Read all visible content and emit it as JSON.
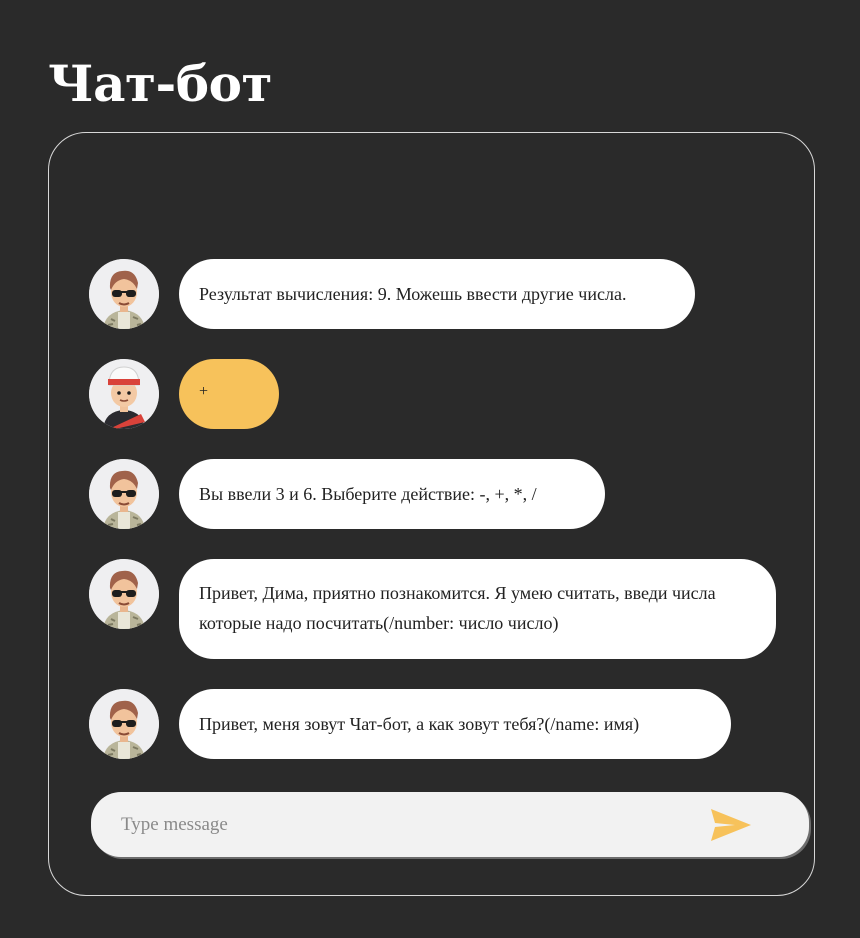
{
  "header": {
    "title": "Чат-бот"
  },
  "chat": {
    "messages": [
      {
        "sender": "bot",
        "avatar": "bot-avatar-icon",
        "text": "Результат вычисления: 9. Можешь ввести другие числа."
      },
      {
        "sender": "user",
        "avatar": "user-avatar-icon",
        "text": "+"
      },
      {
        "sender": "bot",
        "avatar": "bot-avatar-icon",
        "text": "Вы ввели 3 и 6. Выберите действие: -, +, *, /"
      },
      {
        "sender": "bot",
        "avatar": "bot-avatar-icon",
        "text": "Привет, Дима, приятно познакомится. Я умею считать, введи числа которые надо посчитать(/number: число число)"
      },
      {
        "sender": "bot",
        "avatar": "bot-avatar-icon",
        "text": "Привет, меня зовут Чат-бот, а как зовут тебя?(/name: имя)"
      }
    ]
  },
  "composer": {
    "placeholder": "Type message",
    "value": "",
    "send_icon": "send-icon"
  },
  "colors": {
    "background": "#2a2a2a",
    "bot_bubble": "#ffffff",
    "user_bubble": "#f7c25b",
    "accent": "#f7c25b",
    "input_background": "#f2f2f2"
  }
}
